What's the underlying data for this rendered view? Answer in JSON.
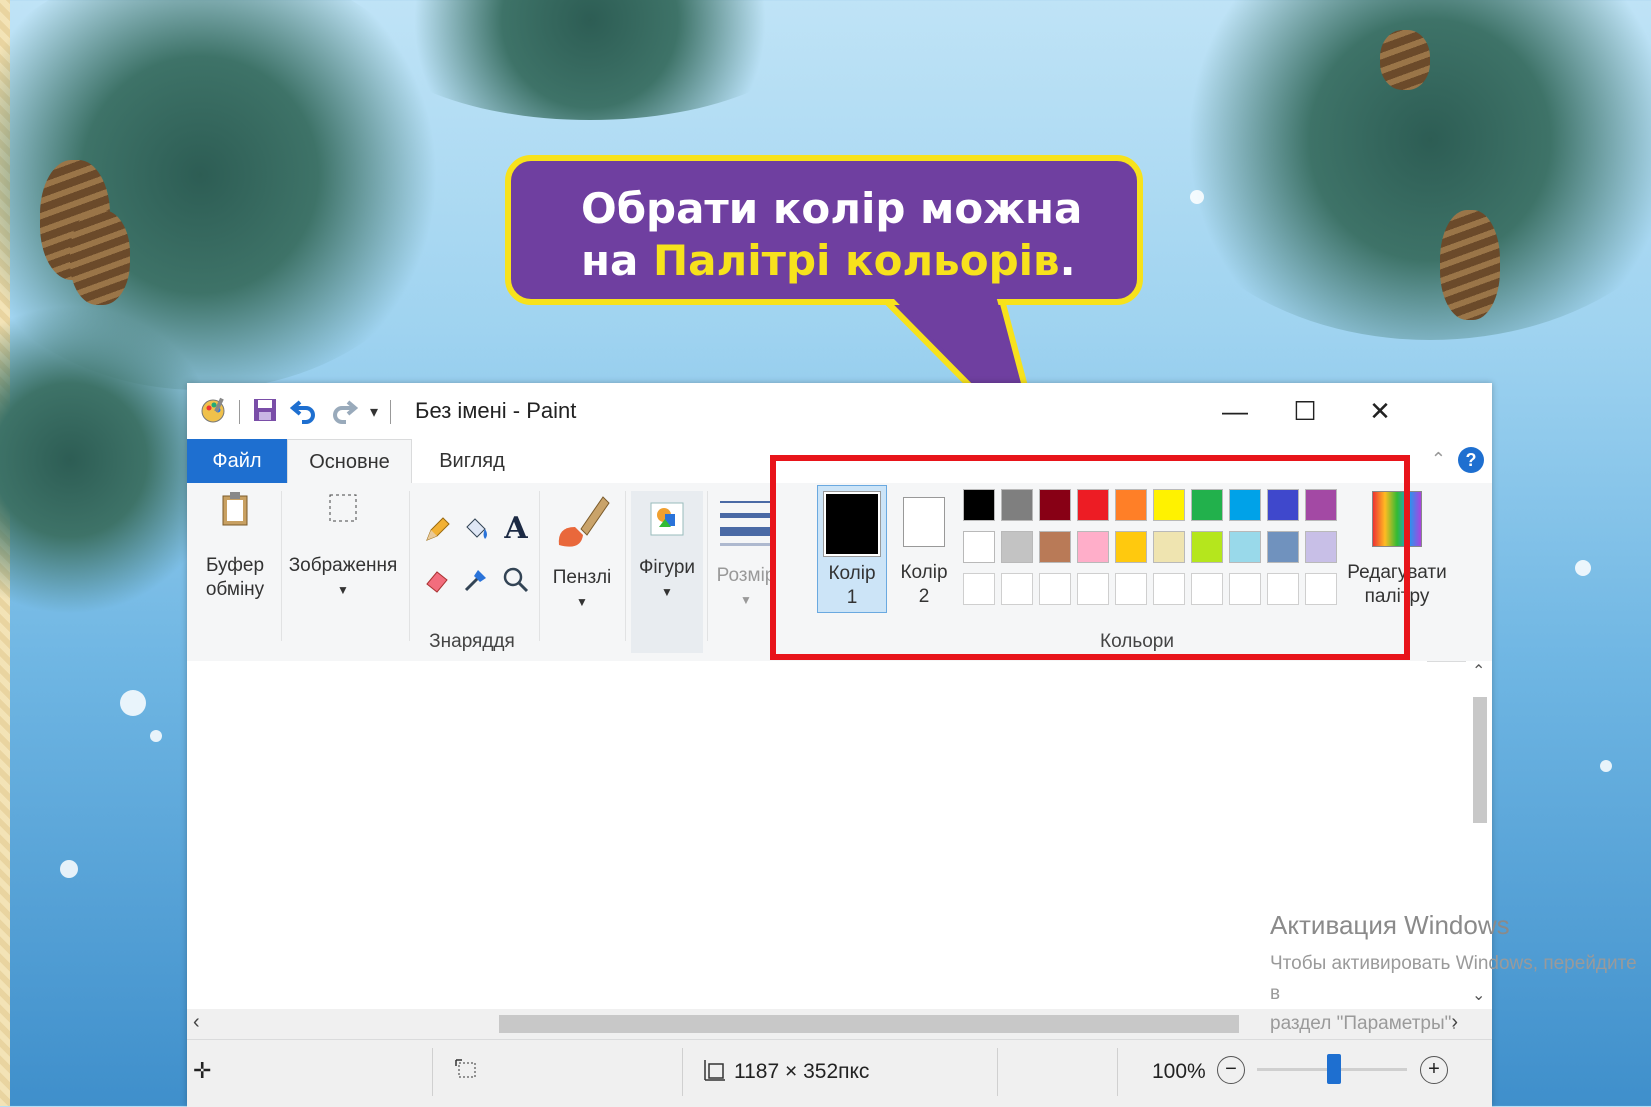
{
  "callout": {
    "line1": "Обрати колір можна",
    "line2_prefix": "на ",
    "line2_highlight": "Палітрі кольорів",
    "line2_suffix": "."
  },
  "window": {
    "title": "Без імені - Paint",
    "controls": {
      "minimize": "—",
      "maximize": "☐",
      "close": "✕"
    },
    "tabs": [
      "Файл",
      "Основне",
      "Вигляд"
    ],
    "help": "?"
  },
  "ribbon": {
    "clipboard": {
      "line1": "Буфер",
      "line2": "обміну"
    },
    "image": {
      "label": "Зображення"
    },
    "tools": {
      "group_label": "Знаряддя"
    },
    "brushes": {
      "label": "Пензлі"
    },
    "shapes": {
      "label": "Фігури"
    },
    "size": {
      "label": "Розмір"
    },
    "colors": {
      "color1": {
        "line1": "Колір",
        "line2": "1"
      },
      "color2": {
        "line1": "Колір",
        "line2": "2"
      },
      "edit": {
        "line1": "Редагувати",
        "line2": "палітру"
      },
      "group_label": "Кольори",
      "row1": [
        "#000000",
        "#7f7f7f",
        "#880015",
        "#ed1c24",
        "#ff7f27",
        "#fff200",
        "#22b14c",
        "#00a2e8",
        "#3f48cc",
        "#a349a4"
      ],
      "row2": [
        "#ffffff",
        "#c3c3c3",
        "#b97a57",
        "#ffaec9",
        "#ffc90e",
        "#efe4b0",
        "#b5e61d",
        "#99d9ea",
        "#7092be",
        "#c8bfe7"
      ]
    }
  },
  "status": {
    "size": "1187 × 352пкс",
    "zoom": "100%"
  },
  "activation": {
    "title": "Активация Windows",
    "line1": "Чтобы активировать Windows, перейдите в",
    "line2": "раздел \"Параметры\"."
  }
}
